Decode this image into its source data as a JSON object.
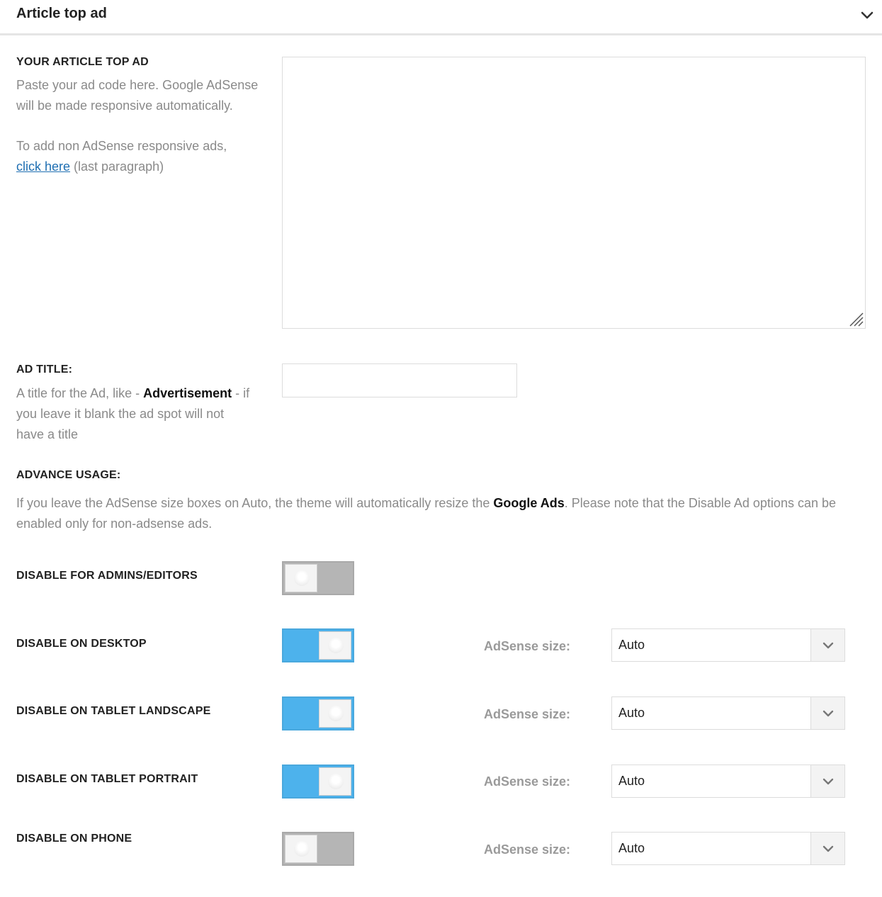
{
  "panel": {
    "title": "Article top ad"
  },
  "ad_code": {
    "label": "YOUR ARTICLE TOP AD",
    "desc_line1": "Paste your ad code here. Google AdSense",
    "desc_line2": "will be made responsive automatically.",
    "desc_line3": "To add non AdSense responsive ads,",
    "link_text": "click here",
    "link_suffix": " (last paragraph)",
    "value": ""
  },
  "ad_title": {
    "label": "AD TITLE:",
    "desc_pre": "A title for the Ad, like - ",
    "desc_bold": "Advertisement",
    "desc_post_1": " - if",
    "desc_line2": "you leave it blank the ad spot will not",
    "desc_line3": "have a title",
    "value": ""
  },
  "advance": {
    "label": "ADVANCE USAGE:",
    "desc_pre": "If you leave the AdSense size boxes on Auto, the theme will automatically resize the ",
    "desc_bold": "Google Ads",
    "desc_post": ". Please note that the Disable Ad options can be",
    "desc_line2": "enabled only for non-adsense ads."
  },
  "rows": [
    {
      "label": "DISABLE FOR ADMINS/EDITORS",
      "toggle": "off"
    },
    {
      "label": "DISABLE ON DESKTOP",
      "toggle": "on",
      "size_label": "AdSense size:",
      "size_value": "Auto"
    },
    {
      "label": "DISABLE ON TABLET LANDSCAPE",
      "toggle": "on",
      "size_label": "AdSense size:",
      "size_value": "Auto"
    },
    {
      "label": "DISABLE ON TABLET PORTRAIT",
      "toggle": "on",
      "size_label": "AdSense size:",
      "size_value": "Auto"
    },
    {
      "label": "DISABLE ON PHONE",
      "toggle": "off",
      "size_label": "AdSense size:",
      "size_value": "Auto"
    }
  ],
  "colors": {
    "accent": "#4db2ec",
    "toggle_off": "#b5b5b5",
    "link": "#1f6fb2"
  },
  "icons": {
    "collapse": "chevron-down-icon",
    "select": "chevron-down-icon",
    "resize": "resize-handle-icon"
  }
}
